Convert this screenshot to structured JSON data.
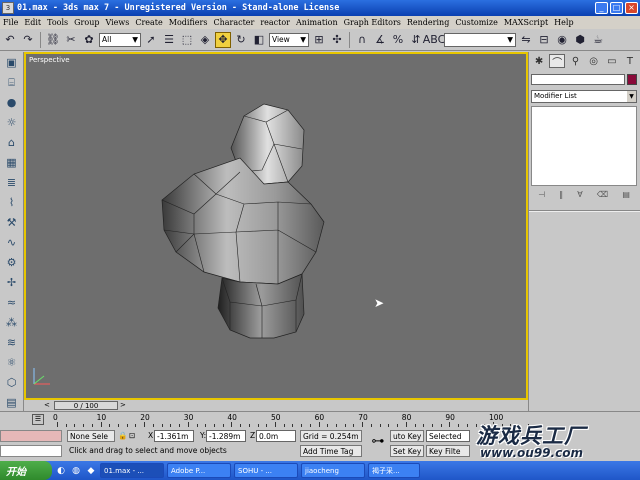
{
  "window": {
    "title": "01.max - 3ds max 7  - Unregistered Version - Stand-alone License",
    "minimize": "_",
    "maximize": "□",
    "close": "×"
  },
  "menu": [
    "File",
    "Edit",
    "Tools",
    "Group",
    "Views",
    "Create",
    "Modifiers",
    "Character",
    "reactor",
    "Animation",
    "Graph Editors",
    "Rendering",
    "Customize",
    "MAXScript",
    "Help"
  ],
  "toolbar": {
    "selection_filter": "All",
    "ref_coord": "View",
    "named_selection": "",
    "move_tool_active": true
  },
  "viewport": {
    "label": "Perspective",
    "border_color": "#e7c600",
    "background": "#6e6e6e"
  },
  "command_panel": {
    "modifier_list": "Modifier List",
    "object_name": "",
    "object_color": "#8a0a3a"
  },
  "timeline": {
    "frame_display": "0 / 100",
    "ruler_labels": [
      "0",
      "10",
      "20",
      "30",
      "40",
      "50",
      "60",
      "70",
      "80",
      "90",
      "100"
    ]
  },
  "status": {
    "selection": "None Sele",
    "x_label": "X:",
    "x_value": "-1.361m",
    "y_label": "Y:",
    "y_value": "-1.289m",
    "z_label": "Z:",
    "z_value": "0.0m",
    "grid": "Grid = 0.254m",
    "auto_key": "uto Key",
    "selected": "Selected",
    "set_key": "Set Key",
    "key_filters": "Key Filte",
    "prompt": "Click and drag to select and move objects",
    "add_time_tag": "Add Time Tag"
  },
  "watermark": {
    "title": "游戏兵工厂",
    "url": "www.ou99.com"
  },
  "taskbar": {
    "start": "开始",
    "tasks": [
      {
        "label": "01.max - ...",
        "active": true
      },
      {
        "label": "Adobe P...",
        "active": false
      },
      {
        "label": "SOHU - ...",
        "active": false
      },
      {
        "label": "jiaocheng",
        "active": false
      },
      {
        "label": "褐子采...",
        "active": false
      }
    ]
  }
}
